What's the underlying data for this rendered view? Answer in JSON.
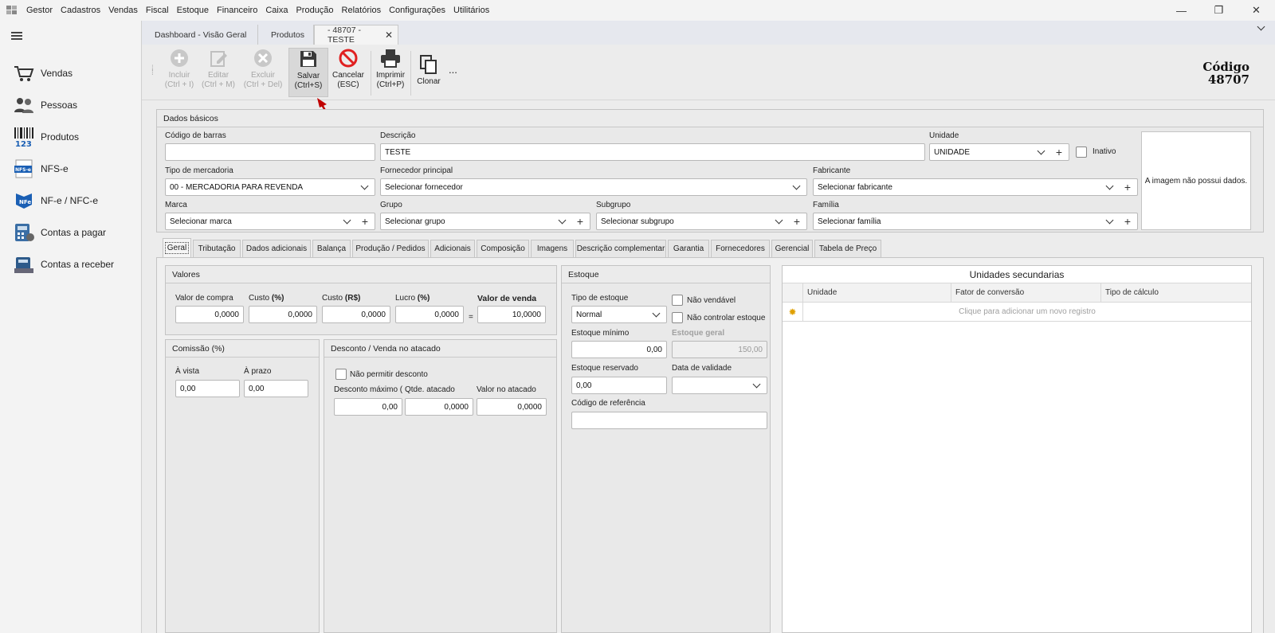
{
  "menubar": {
    "items": [
      "Gestor",
      "Cadastros",
      "Vendas",
      "Fiscal",
      "Estoque",
      "Financeiro",
      "Caixa",
      "Produção",
      "Relatórios",
      "Configurações",
      "Utilitários"
    ]
  },
  "sidebar": {
    "items": [
      {
        "label": "Vendas",
        "icon": "cart-icon"
      },
      {
        "label": "Pessoas",
        "icon": "people-icon"
      },
      {
        "label": "Produtos",
        "icon": "barcode-icon"
      },
      {
        "label": "NFS-e",
        "icon": "nfse-icon"
      },
      {
        "label": "NF-e / NFC-e",
        "icon": "nfe-icon"
      },
      {
        "label": "Contas a pagar",
        "icon": "calculator-icon"
      },
      {
        "label": "Contas a receber",
        "icon": "money-icon"
      }
    ]
  },
  "doc_tabs": [
    "Dashboard - Visão Geral",
    "Produtos",
    "- 48707 - TESTE"
  ],
  "toolbar": {
    "incluir": [
      "Incluir",
      "(Ctrl + I)"
    ],
    "editar": [
      "Editar",
      "(Ctrl + M)"
    ],
    "excluir": [
      "Excluir",
      "(Ctrl + Del)"
    ],
    "salvar": [
      "Salvar",
      "(Ctrl+S)"
    ],
    "cancelar": [
      "Cancelar",
      "(ESC)"
    ],
    "imprimir": [
      "Imprimir",
      "(Ctrl+P)"
    ],
    "clonar": "Clonar",
    "more": "..."
  },
  "codigo": {
    "label": "Código",
    "value": "48707"
  },
  "dados_basicos": {
    "title": "Dados básicos",
    "codigo_barras_label": "Código de barras",
    "codigo_barras": "",
    "descricao_label": "Descrição",
    "descricao": "TESTE",
    "unidade_label": "Unidade",
    "unidade": "UNIDADE",
    "inativo_label": "Inativo",
    "tipo_label": "Tipo de mercadoria",
    "tipo": "00 - MERCADORIA PARA REVENDA",
    "fornecedor_label": "Fornecedor principal",
    "fornecedor": "Selecionar fornecedor",
    "fabricante_label": "Fabricante",
    "fabricante": "Selecionar fabricante",
    "marca_label": "Marca",
    "marca": "Selecionar marca",
    "grupo_label": "Grupo",
    "grupo": "Selecionar grupo",
    "subgrupo_label": "Subgrupo",
    "subgrupo": "Selecionar subgrupo",
    "familia_label": "Família",
    "familia": "Selecionar família",
    "imagem_text": "A imagem não possui dados."
  },
  "page_tabs": [
    "Geral",
    "Tributação",
    "Dados adicionais",
    "Balança",
    "Produção / Pedidos",
    "Adicionais",
    "Composição",
    "Imagens",
    "Descrição complementar",
    "Garantia",
    "Fornecedores",
    "Gerencial",
    "Tabela de Preço"
  ],
  "valores": {
    "title": "Valores",
    "valor_compra_label": "Valor de compra",
    "valor_compra": "0,0000",
    "custo_pct_label": "Custo",
    "custo_pct_unit": "(%)",
    "custo_pct": "0,0000",
    "custo_rs_label": "Custo",
    "custo_rs_unit": "(R$)",
    "custo_rs": "0,0000",
    "lucro_label": "Lucro",
    "lucro_unit": "(%)",
    "lucro": "0,0000",
    "equals": "=",
    "valor_venda_label": "Valor de venda",
    "valor_venda": "10,0000"
  },
  "comissao": {
    "title": "Comissão (%)",
    "vista_label": "À vista",
    "vista": "0,00",
    "prazo_label": "À prazo",
    "prazo": "0,00"
  },
  "desconto": {
    "title": "Desconto / Venda no atacado",
    "nao_permitir": "Não permitir desconto",
    "desc_max_label": "Desconto máximo (%",
    "desc_max": "0,00",
    "qtde_label": "Qtde. atacado",
    "qtde": "0,0000",
    "valor_atacado_label": "Valor no atacado",
    "valor_atacado": "0,0000"
  },
  "estoque": {
    "title": "Estoque",
    "tipo_label": "Tipo de estoque",
    "tipo": "Normal",
    "nao_vendavel": "Não vendável",
    "nao_controlar": "Não controlar estoque",
    "minimo_label": "Estoque mínimo",
    "minimo": "0,00",
    "geral_label": "Estoque geral",
    "geral": "150,00",
    "reservado_label": "Estoque reservado",
    "reservado": "0,00",
    "validade_label": "Data de validade",
    "validade": "",
    "referencia_label": "Código de referência",
    "referencia": ""
  },
  "unidades": {
    "title": "Unidades secundarias",
    "columns": [
      "Unidade",
      "Fator de conversão",
      "Tipo de cálculo"
    ],
    "new_row": "Clique para adicionar um novo registro"
  }
}
